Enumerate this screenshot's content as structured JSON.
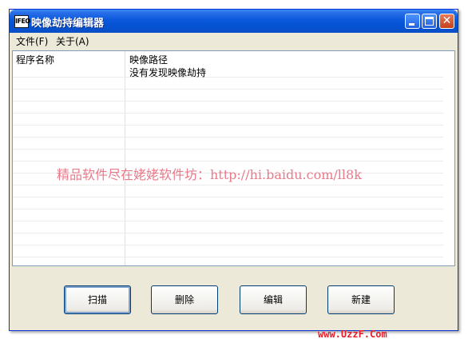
{
  "window": {
    "title": "映像劫持编辑器",
    "app_icon_text": "IFEO"
  },
  "menu": {
    "file": "文件(F)",
    "about": "关于(A)"
  },
  "list": {
    "columns": [
      "程序名称",
      "映像路径"
    ],
    "rows": [
      {
        "name": "",
        "path": "没有发现映像劫持"
      }
    ]
  },
  "buttons": {
    "scan": "扫描",
    "delete": "删除",
    "edit": "编辑",
    "new": "新建"
  },
  "watermark": "精品软件尽在姥姥软件坊：http://hi.baidu.com/ll8k",
  "footer_watermark": "www.UzzF.Com",
  "colors": {
    "titlebar": "#0453d2",
    "window_bg": "#ece9d8",
    "watermark": "#e87a8a",
    "footer": "#e8202a"
  }
}
